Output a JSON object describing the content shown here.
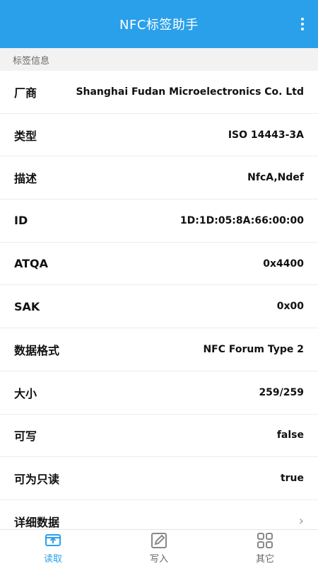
{
  "appbar": {
    "title": "NFC标签助手",
    "menu_icon": "more-vertical-icon"
  },
  "section": {
    "title": "标签信息"
  },
  "rows": [
    {
      "label": "厂商",
      "value": "Shanghai Fudan Microelectronics Co. Ltd"
    },
    {
      "label": "类型",
      "value": "ISO 14443-3A"
    },
    {
      "label": "描述",
      "value": "NfcA,Ndef"
    },
    {
      "label": "ID",
      "value": "1D:1D:05:8A:66:00:00"
    },
    {
      "label": "ATQA",
      "value": "0x4400"
    },
    {
      "label": "SAK",
      "value": "0x00"
    },
    {
      "label": "数据格式",
      "value": "NFC Forum Type 2"
    },
    {
      "label": "大小",
      "value": "259/259"
    },
    {
      "label": "可写",
      "value": "false"
    },
    {
      "label": "可为只读",
      "value": "true"
    },
    {
      "label": "详细数据",
      "value": "›"
    }
  ],
  "nav": [
    {
      "label": "读取",
      "icon": "read-icon",
      "active": true
    },
    {
      "label": "写入",
      "icon": "write-icon",
      "active": false
    },
    {
      "label": "其它",
      "icon": "grid-icon",
      "active": false
    }
  ],
  "colors": {
    "accent": "#2aa0ea",
    "inactive": "#888888"
  }
}
